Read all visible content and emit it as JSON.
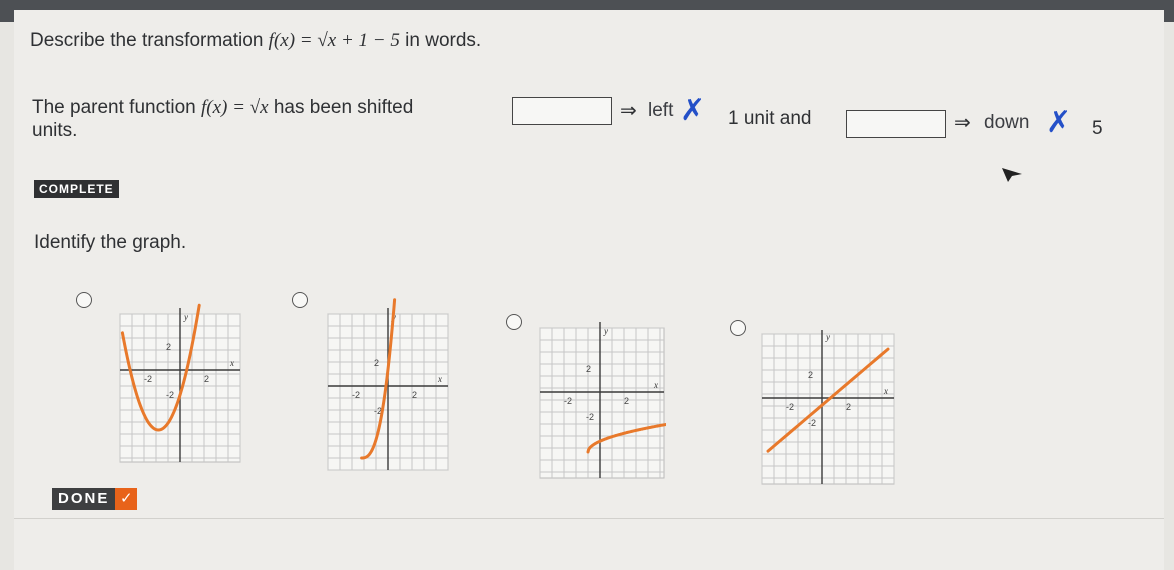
{
  "question1": {
    "prompt_start": "Describe the transformation ",
    "formula": "f(x) = √x + 1 − 5",
    "prompt_end": " in words.",
    "sentence_start": "The parent function ",
    "parent_formula": "f(x) = √x",
    "sentence_mid": " has been shifted",
    "answer1": "left",
    "amount1": "1 unit and",
    "answer2": "down",
    "amount2": "5",
    "units": "units."
  },
  "complete_badge": "COMPLETE",
  "question2": {
    "prompt": "Identify the graph."
  },
  "graphs": [
    {
      "id": "A",
      "curve": "parabola",
      "axis_label_x": "x",
      "axis_label_y": "y",
      "ticks": [
        "2",
        "-2",
        "2",
        "-2"
      ]
    },
    {
      "id": "B",
      "curve": "sqrt-steep",
      "axis_label_x": "x",
      "axis_label_y": "y",
      "ticks": [
        "2",
        "-2",
        "2",
        "-2"
      ]
    },
    {
      "id": "C",
      "curve": "sqrt-shifted",
      "axis_label_x": "x",
      "axis_label_y": "y",
      "ticks": [
        "2",
        "-2",
        "2",
        "-2"
      ]
    },
    {
      "id": "D",
      "curve": "line",
      "axis_label_x": "x",
      "axis_label_y": "y",
      "ticks": [
        "2",
        "-2",
        "2",
        "-2"
      ]
    }
  ],
  "done_button": "DONE",
  "colors": {
    "curve": "#e8792b",
    "xmark": "#2450c8",
    "badge": "#2f3032"
  },
  "icons": {
    "arrow": "⇒",
    "wrong": "✗",
    "check": "✓"
  }
}
